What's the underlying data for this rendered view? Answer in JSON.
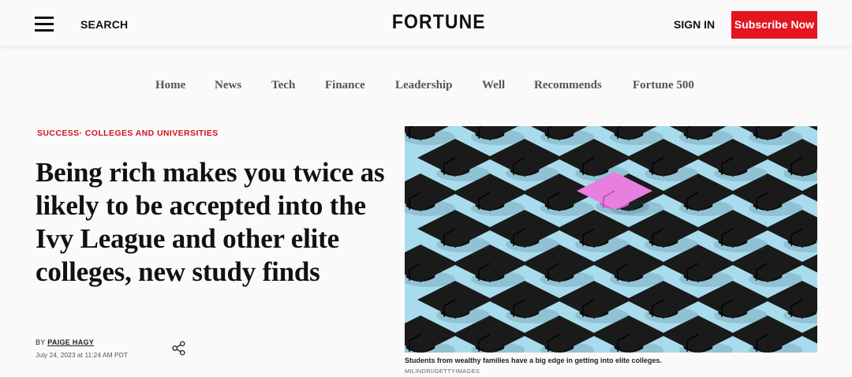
{
  "header": {
    "search_label": "SEARCH",
    "logo_text": "FORTUNE",
    "signin_label": "SIGN IN",
    "subscribe_label": "Subscribe Now",
    "subscribe_color": "#e4151f"
  },
  "nav": {
    "items": [
      "Home",
      "News",
      "Tech",
      "Finance",
      "Leadership",
      "Well",
      "Recommends",
      "Fortune 500"
    ]
  },
  "article": {
    "kicker_section": "SUCCESS",
    "kicker_sep": "·",
    "kicker_topic": "COLLEGES AND UNIVERSITIES",
    "headline": "Being rich makes you twice as likely to be accepted into the Ivy League and other elite colleges, new study finds",
    "by_label": "BY",
    "author": "PAIGE HAGY",
    "date": "July 24, 2023 at 11:24 AM PDT",
    "image": {
      "description_icon": "graduation-caps-image",
      "background_color": "#a8dcec",
      "cap_color": "#1a1a1a",
      "highlight_cap_color": "#e77ee0",
      "caption": "Students from wealthy families have a big edge in getting into elite colleges.",
      "credit": "MILINDRI/GETTYIMAGES"
    }
  }
}
